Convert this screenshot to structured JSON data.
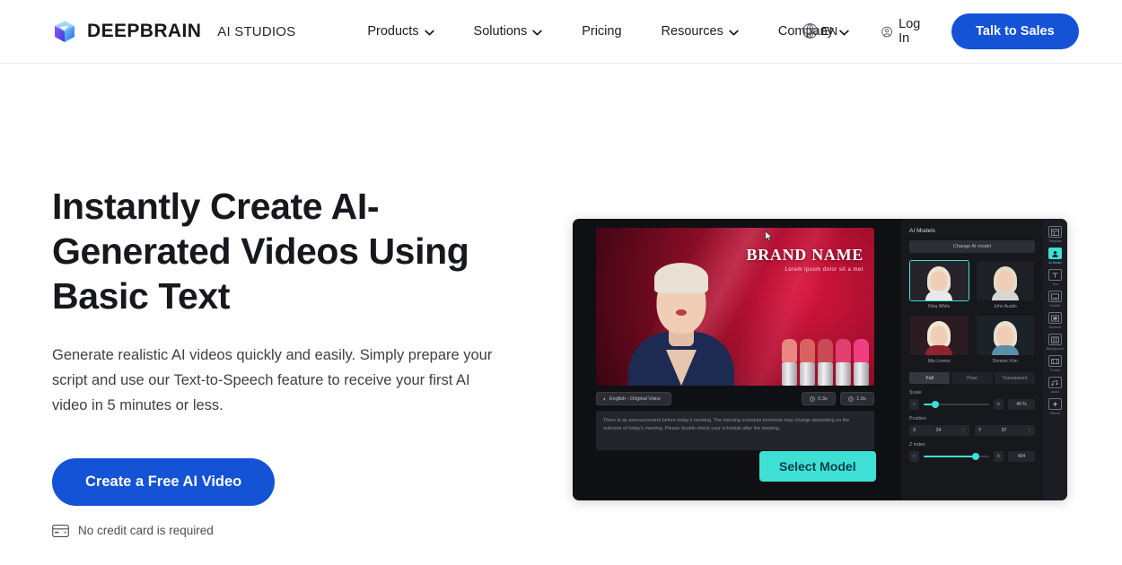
{
  "brand": {
    "name": "DEEPBRAIN",
    "suffix": "AI STUDIOS",
    "logo_icon": "cube-logo-icon"
  },
  "nav": {
    "items": [
      {
        "label": "Products",
        "has_dropdown": true
      },
      {
        "label": "Solutions",
        "has_dropdown": true
      },
      {
        "label": "Pricing",
        "has_dropdown": false
      },
      {
        "label": "Resources",
        "has_dropdown": true
      },
      {
        "label": "Company",
        "has_dropdown": true
      }
    ],
    "language": {
      "code": "EN",
      "icon": "globe-icon"
    },
    "login": {
      "label": "Log In",
      "icon": "user-circle-icon"
    },
    "cta": {
      "label": "Talk to Sales"
    }
  },
  "hero": {
    "title": "Instantly Create AI-Generated Videos Using Basic Text",
    "subtitle": "Generate realistic AI videos quickly and easily. Simply prepare your script and use our Text-to-Speech feature to receive your first AI video in 5 minutes or less.",
    "cta_label": "Create a Free AI Video",
    "note": "No credit card is required",
    "note_icon": "credit-card-icon"
  },
  "colors": {
    "primary_blue": "#1452d6",
    "accent_teal": "#3ee0d6",
    "text_dark": "#16181d",
    "app_bg": "#0e1013"
  },
  "app_preview": {
    "video": {
      "brand_name": "BRAND NAME",
      "brand_tagline": "Lorem ipsum dolor sit a met"
    },
    "toolbar": {
      "language_chip": "English - Original Voice",
      "language_chip_icon": "voice-icon",
      "pause_chip": "0.3s",
      "pause_chip_icon": "clock-icon",
      "duration_chip": "1.0s",
      "duration_chip_icon": "clock-icon"
    },
    "script": "There is an announcement before today's meeting. The morning schedule tomorrow may change depending on the outcome of today's meeting. Please double-check your schedule after the meeting.",
    "select_model_button": "Select Model",
    "panel": {
      "title": "AI Models",
      "change_button": "Change AI model",
      "models": [
        {
          "name": "Nina White",
          "selected": true
        },
        {
          "name": "John Austin",
          "selected": false
        },
        {
          "name": "Mia Lorenz",
          "selected": false
        },
        {
          "name": "Dominic Kim",
          "selected": false
        }
      ],
      "segments": [
        {
          "label": "Full",
          "active": true
        },
        {
          "label": "Pose",
          "active": false
        },
        {
          "label": "Transparent",
          "active": false
        }
      ],
      "controls": [
        {
          "label": "Scale",
          "value": "40 %"
        },
        {
          "label": "Position",
          "value_x": "24",
          "value_y": "87"
        },
        {
          "label": "Z index",
          "value": "404"
        }
      ]
    },
    "rail": [
      {
        "label": "Template",
        "icon": "template-icon",
        "active": false
      },
      {
        "label": "AI Model",
        "icon": "ai-model-icon",
        "active": true
      },
      {
        "label": "Text",
        "icon": "text-icon",
        "active": false
      },
      {
        "label": "Subtitle",
        "icon": "subtitle-icon",
        "active": false
      },
      {
        "label": "Element",
        "icon": "element-icon",
        "active": false
      },
      {
        "label": "Background",
        "icon": "background-icon",
        "active": false
      },
      {
        "label": "Frame",
        "icon": "frame-icon",
        "active": false
      },
      {
        "label": "Audio",
        "icon": "audio-icon",
        "active": false
      },
      {
        "label": "Effects",
        "icon": "effects-icon",
        "active": false
      }
    ]
  }
}
